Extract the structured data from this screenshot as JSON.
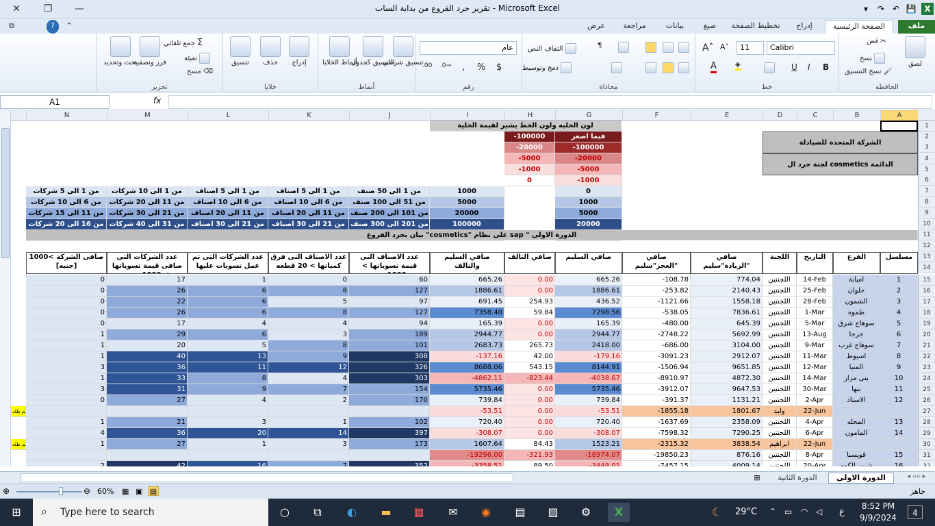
{
  "window": {
    "title": "تقرير جرد الفروع من بداية الساب - Microsoft Excel"
  },
  "tabs": [
    "الصفحة الرئيسية",
    "إدراج",
    "تخطيط الصفحة",
    "صيغ",
    "بيانات",
    "مراجعة",
    "عرض"
  ],
  "file_tab": "ملف",
  "ribbon": {
    "clipboard": {
      "label": "الحافظة",
      "paste": "لصق",
      "cut": "قص",
      "copy": "نسخ",
      "format_painter": "نسخ التنسيق"
    },
    "font": {
      "label": "خط",
      "name": "Calibri",
      "size": "11",
      "bold": "B",
      "italic": "I",
      "underline": "U"
    },
    "alignment": {
      "label": "محاذاة",
      "wrap": "التفاف النص",
      "merge": "دمج وتوسيط"
    },
    "number": {
      "label": "رقم",
      "format": "عام",
      "percent": "%",
      "currency": "$",
      "comma": ","
    },
    "styles": {
      "label": "أنماط",
      "conditional": "تنسيق شرطي",
      "table": "التنسيق كجدول",
      "cell": "أنماط الخلايا"
    },
    "cells": {
      "label": "خلايا",
      "insert": "إدراج",
      "delete": "حذف",
      "format": "تنسيق"
    },
    "editing": {
      "label": "تحرير",
      "autosum": "جمع تلقائي",
      "fill": "تعبئة",
      "clear": "مسح",
      "sort": "فرز وتصفية",
      "find": "بحث وتحديد"
    }
  },
  "formula_bar": {
    "name_box": "A1",
    "fx": "fx",
    "value": ""
  },
  "columns": [
    "A",
    "B",
    "C",
    "D",
    "E",
    "F",
    "G",
    "H",
    "I",
    "J",
    "K",
    "L",
    "M",
    "N"
  ],
  "legend": {
    "title": "لون الخليه ولون الخط يشير لقيمة الخلية",
    "header": "فيما اصغر",
    "g": [
      "-100000",
      "-20000",
      "-5000",
      "-1000"
    ],
    "h": [
      "-100000",
      "-20000",
      "-5000",
      "-1000",
      "0"
    ]
  },
  "company": {
    "name": "الشركة المتحدة للصيادلة",
    "committee": "لجنة جرد ال cosmetics الدائمة"
  },
  "scale": {
    "g": [
      "0",
      "1000",
      "5000",
      "20000",
      "100000"
    ],
    "h": [
      "1000",
      "5000",
      "20000",
      "100000",
      "فيما اكبر"
    ],
    "j": [
      "من 1 الى 50 صنف",
      "من 51 الى 100 صنف",
      "من 101 الى 200 صنف",
      "من 201 الى 300 صنف",
      "من 301 الى فيما فوق"
    ],
    "k": [
      "من 1 الى 5 اصناف",
      "من 6 الى 10 اصناف",
      "من 11 الى 20 اصناف",
      "من 21 الى 30 اصناف",
      "من 31 الى فيما فوق"
    ],
    "l": [
      "من 1 الى 5 اصناف",
      "من 6 الى 10 اصناف",
      "من 11 الى 20 اصناف",
      "من 21 الى 30 اصناف",
      "من 31 الى فيما فوق"
    ],
    "m": [
      "من 1 الى 10 شركات",
      "من 11 الى 20 شركات",
      "من 21 الى 30 شركات",
      "من 31 الى 40 شركات",
      "من 41 الى فيما فوق"
    ],
    "n": [
      "من 1 الى 5 شركات",
      "من 6 الى 10 شركات",
      "من 11 الى 15 شركات",
      "من 16 الى 20 شركات",
      "من 21 الى فيما فوق"
    ]
  },
  "section_title": "بيان بجرد الفروع \"cosmetics\" على نظام sap \" الدورة الاولى",
  "headers": [
    "مسلسل",
    "الفرع",
    "التاريخ",
    "اللجنة",
    "صافي الزيادة\"سليم\"",
    "صافي العجز\"سليم\"",
    "صافي السليم",
    "صافي التالف",
    "صافي السليم والتالف",
    "عدد الاصناف التى قيمة تسوياتها > 1000جنيه",
    "عدد الاصناف التى فرق كمياتها > 20 قطعه",
    "عدد الشركات التى تم عمل تسويات عليها",
    "عدد الشركات التى صافى قيمة تسوياتها > 1000 جنيه",
    "صافى الشركة >1000 [جنيه]"
  ],
  "rows": [
    {
      "r": "15",
      "a": "1",
      "b": "امبابة",
      "c": "14-Feb",
      "d": "اللجنتين",
      "e": "774.04",
      "f": "-108.78",
      "g": "665.26",
      "h": "0.00",
      "i": "665.26",
      "j": "60",
      "k": "0",
      "l": "1",
      "m": "17",
      "n": "0"
    },
    {
      "r": "16",
      "a": "2",
      "b": "حلوان",
      "c": "25-Feb",
      "d": "اللجنتين",
      "e": "2140.43",
      "f": "-253.82",
      "g": "1886.61",
      "h": "0.00",
      "i": "1886.61",
      "j": "127",
      "k": "8",
      "l": "6",
      "m": "26",
      "n": "0"
    },
    {
      "r": "17",
      "a": "3",
      "b": "الشمون",
      "c": "28-Feb",
      "d": "اللجنتين",
      "e": "1558.18",
      "f": "-1121.66",
      "g": "436.52",
      "h": "254.93",
      "i": "691.45",
      "j": "97",
      "k": "5",
      "l": "6",
      "m": "22",
      "n": "0"
    },
    {
      "r": "18",
      "a": "4",
      "b": "طموه",
      "c": "1-Mar",
      "d": "اللجنتين",
      "e": "7836.61",
      "f": "-538.05",
      "g": "7298.56",
      "h": "59.84",
      "i": "7358.40",
      "j": "127",
      "k": "8",
      "l": "6",
      "m": "26",
      "n": "0"
    },
    {
      "r": "19",
      "a": "5",
      "b": "سوهاج شرق",
      "c": "5-Mar",
      "d": "اللجنتين",
      "e": "645.39",
      "f": "-480.00",
      "g": "165.39",
      "h": "0.00",
      "i": "165.39",
      "j": "94",
      "k": "4",
      "l": "4",
      "m": "17",
      "n": "0"
    },
    {
      "r": "20",
      "a": "6",
      "b": "جرجا",
      "c": "13-Aug",
      "d": "اللجنتين",
      "e": "5692.99",
      "f": "-2748.22",
      "g": "2944.77",
      "h": "0.00",
      "i": "2944.77",
      "j": "189",
      "k": "3",
      "l": "6",
      "m": "29",
      "n": "1"
    },
    {
      "r": "21",
      "a": "7",
      "b": "سوهاج غرب",
      "c": "9-Mar",
      "d": "اللجنتين",
      "e": "3104.00",
      "f": "-686.00",
      "g": "2418.00",
      "h": "265.73",
      "i": "2683.73",
      "j": "101",
      "k": "8",
      "l": "5",
      "m": "20",
      "n": "1"
    },
    {
      "r": "22",
      "a": "8",
      "b": "اسيوط",
      "c": "11-Mar",
      "d": "اللجنتين",
      "e": "2912.07",
      "f": "-3091.23",
      "g": "-179.16",
      "h": "42.00",
      "i": "-137.16",
      "j": "308",
      "k": "9",
      "l": "13",
      "m": "40",
      "n": "1"
    },
    {
      "r": "23",
      "a": "9",
      "b": "المنيا",
      "c": "12-Mar",
      "d": "اللجنتين",
      "e": "9651.85",
      "f": "-1506.94",
      "g": "8144.91",
      "h": "543.15",
      "i": "8688.06",
      "j": "326",
      "k": "12",
      "l": "11",
      "m": "36",
      "n": "3"
    },
    {
      "r": "24",
      "a": "10",
      "b": "بنى مزار",
      "c": "14-Mar",
      "d": "اللجنتين",
      "e": "4872.30",
      "f": "-8910.97",
      "g": "-4038.67",
      "h": "-823.44",
      "i": "-4862.11",
      "j": "303",
      "k": "4",
      "l": "8",
      "m": "33",
      "n": "1"
    },
    {
      "r": "25",
      "a": "11",
      "b": "بنها",
      "c": "30-Mar",
      "d": "اللجنتين",
      "e": "9647.53",
      "f": "-3912.07",
      "g": "5735.46",
      "h": "0.00",
      "i": "5735.46",
      "j": "154",
      "k": "7",
      "l": "9",
      "m": "31",
      "n": "3"
    },
    {
      "r": "26",
      "a": "12",
      "b": "الاستاد",
      "c": "2-Apr",
      "d": "اللجنتين",
      "e": "1131.21",
      "f": "-391.37",
      "g": "739.84",
      "h": "0.00",
      "i": "739.84",
      "j": "170",
      "k": "2",
      "l": "4",
      "m": "27",
      "n": "0"
    },
    {
      "r": "27",
      "a": "",
      "b": "",
      "c": "22-Jun",
      "d": "وليد",
      "e": "1801.67",
      "f": "-1855.18",
      "g": "-53.51",
      "h": "0.00",
      "i": "-53.51",
      "j": "",
      "k": "",
      "l": "",
      "m": "",
      "n": "",
      "o": "تم ظله"
    },
    {
      "r": "28",
      "a": "13",
      "b": "المحله",
      "c": "4-Apr",
      "d": "اللجنتين",
      "e": "2358.09",
      "f": "-1637.69",
      "g": "720.40",
      "h": "0.00",
      "i": "720.40",
      "j": "102",
      "k": "1",
      "l": "3",
      "m": "21",
      "n": "1"
    },
    {
      "r": "29",
      "a": "14",
      "b": "المامون",
      "c": "6-Apr",
      "d": "اللجنتين",
      "e": "7290.25",
      "f": "-7598.32",
      "g": "-308.07",
      "h": "0.00",
      "i": "-308.07",
      "j": "397",
      "k": "14",
      "l": "20",
      "m": "36",
      "n": "4"
    },
    {
      "r": "30",
      "a": "",
      "b": "",
      "c": "22-Jun",
      "d": "ابراهيم",
      "e": "3838.54",
      "f": "-2315.32",
      "g": "1523.21",
      "h": "84.43",
      "i": "1607.64",
      "j": "173",
      "k": "3",
      "l": "1",
      "m": "27",
      "n": "1",
      "o": "تم ظله"
    },
    {
      "r": "31",
      "a": "15",
      "b": "قويسنا",
      "c": "8-Apr",
      "d": "اللجنتين",
      "e": "876.16",
      "f": "-19850.23",
      "g": "-18974.07",
      "h": "-321.93",
      "i": "-19296.00",
      "j": "",
      "k": "",
      "l": "",
      "m": "",
      "n": ""
    },
    {
      "r": "32",
      "a": "16",
      "b": "شبين الكوم",
      "c": "20-Apr",
      "d": "اللجنتين",
      "e": "4009.14",
      "f": "-7457.15",
      "g": "-3448.01",
      "h": "89.50",
      "i": "-3358.51",
      "j": "352",
      "k": "7",
      "l": "16",
      "m": "42",
      "n": "2"
    }
  ],
  "header_rows": [
    "1",
    "2",
    "3",
    "4",
    "5",
    "6",
    "7",
    "8",
    "9",
    "10",
    "11",
    "12",
    "13",
    "14"
  ],
  "sheets": [
    "الدورة الاولى",
    "الدورة الثانية"
  ],
  "status": {
    "ready": "جاهز",
    "zoom": "60%"
  },
  "taskbar": {
    "search": "Type here to search",
    "time": "8:52 PM",
    "date": "9/9/2024",
    "temp": "29°C",
    "lang": "ع",
    "notif": "4"
  },
  "colors": {
    "accent": "#2e7a2e",
    "dark_blue": "#1f3864",
    "mid_blue": "#8eaadb",
    "light_blue": "#c6d3ea",
    "dark_red": "#7b1c1c",
    "pink": "#f4b6b6",
    "orange": "#f8c49c"
  }
}
